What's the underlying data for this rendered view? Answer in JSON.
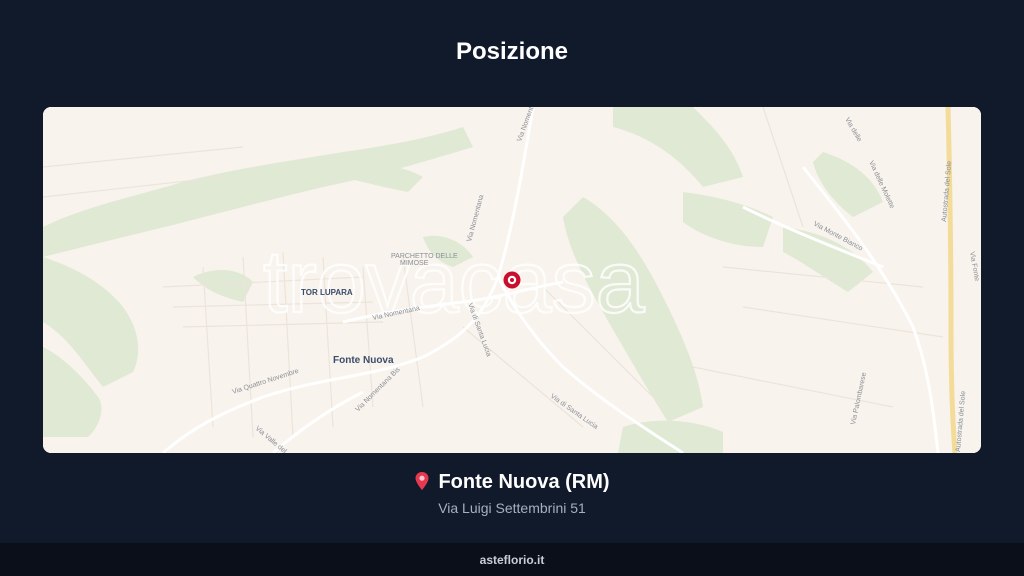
{
  "page": {
    "title": "Posizione"
  },
  "map": {
    "watermark": "trovacasa",
    "labels": {
      "tor_lupara": "TOR LUPARA",
      "fonte_nuova": "Fonte Nuova",
      "parchetto": "PARCHETTO DELLE",
      "mimose": "MIMOSE",
      "via_nomentana_1": "Via Nomentana",
      "via_nomentana_2": "Via Nomentana",
      "via_nomentana_3": "Via Nomentana",
      "via_nomentana_bis": "Via Nomentana Bis",
      "via_quattro_novembre": "Via Quattro Novembre",
      "via_valle_del": "Via Valle del",
      "via_santa_lucia_1": "Via di Santa Lucia",
      "via_santa_lucia_2": "Via di Santa Lucia",
      "via_monte_bianco": "Via Monte Bianco",
      "via_palombarese": "Via Palombarese",
      "autostrada_1": "Autostrada del Sole",
      "autostrada_2": "Autostrada del Sole",
      "via_fonte": "Via Fonte",
      "via_delle_1": "Via delle",
      "via_delle_2": "Via delle Molette"
    },
    "marker": "map-pin"
  },
  "location": {
    "icon": "pin-icon",
    "city": "Fonte Nuova (RM)",
    "address": "Via Luigi Settembrini 51"
  },
  "footer": {
    "brand": "asteflorio.it"
  },
  "colors": {
    "background": "#111a2b",
    "footer": "#0a0f19",
    "map_land": "#f8f3ec",
    "map_green": "#dfe9d4",
    "marker": "#c8102e",
    "highway": "#f3dc9a"
  }
}
